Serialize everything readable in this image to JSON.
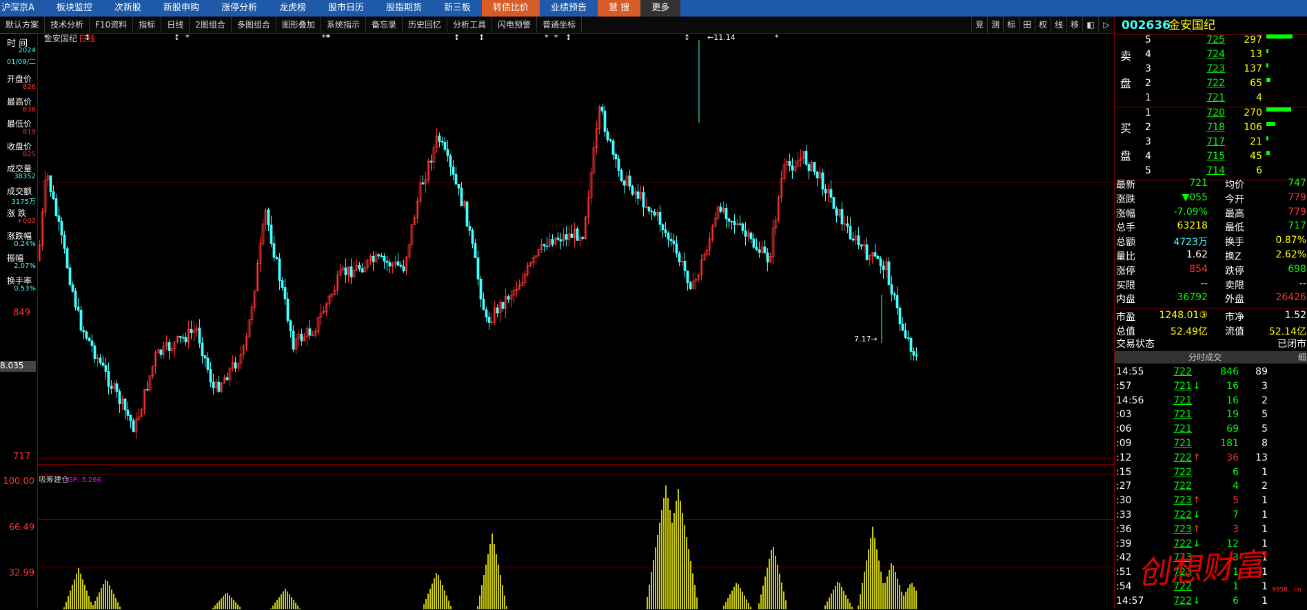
{
  "nav": {
    "items": [
      "沪深京A",
      "板块监控",
      "次新股",
      "新股申购",
      "涨停分析",
      "龙虎榜",
      "股市日历",
      "股指期货",
      "新三板",
      "转债比价",
      "业绩预告",
      "慧 搜",
      "更多"
    ]
  },
  "toolbar": {
    "items": [
      "默认方案",
      "技术分析",
      "F10资料",
      "指标",
      "日线",
      "2图组合",
      "多图组合",
      "图形叠加",
      "系统指示",
      "备忘录",
      "历史回忆",
      "分析工具",
      "闪电预警",
      "普通坐标"
    ],
    "icons": [
      "竞",
      "测",
      "标",
      "田",
      "权",
      "线",
      "移",
      "◧",
      "▷"
    ]
  },
  "left_panel": {
    "time_label": "时 间",
    "year": "2024",
    "date": "01/09/二",
    "rows": [
      {
        "label": "开盘价",
        "value": "826"
      },
      {
        "label": "最高价",
        "value": "836"
      },
      {
        "label": "最低价",
        "value": "819"
      },
      {
        "label": "收盘价",
        "value": "825"
      },
      {
        "label": "成交量",
        "value": "38352"
      },
      {
        "label": "成交额",
        "value": "3175万"
      },
      {
        "label": "涨 跌",
        "value": "+002"
      },
      {
        "label": "涨跌幅",
        "value": "0.24%"
      },
      {
        "label": "振幅",
        "value": "2.07%"
      },
      {
        "label": "换手率",
        "value": "0.53%"
      }
    ]
  },
  "chart": {
    "stock_name": "金安国纪",
    "period": "日线",
    "high_label": "11.14",
    "low_label": "7.17",
    "price_axis": [
      "849",
      "717"
    ],
    "crosshair_value": "8.035",
    "indicator_name": "吸筹建仓",
    "indicator_value": "GP: 3.266",
    "indicator_axis": [
      "100.00",
      "66.49",
      "32.99"
    ],
    "markers": [
      "*",
      "↕",
      "↕",
      "*",
      "**",
      "*",
      "↕",
      "↕",
      "*",
      "*",
      "↕",
      "↕"
    ]
  },
  "quote": {
    "code": "002636",
    "name": "金安国纪",
    "sell_label": [
      "卖",
      "盘"
    ],
    "buy_label": [
      "买",
      "盘"
    ],
    "asks": [
      {
        "lvl": "5",
        "price": "725",
        "vol": "297",
        "bar": 0.9
      },
      {
        "lvl": "4",
        "price": "724",
        "vol": "13",
        "bar": 0.05
      },
      {
        "lvl": "3",
        "price": "723",
        "vol": "137",
        "bar": 0.08
      },
      {
        "lvl": "2",
        "price": "722",
        "vol": "65",
        "bar": 0.15
      },
      {
        "lvl": "1",
        "price": "721",
        "vol": "4",
        "bar": 0.0
      }
    ],
    "bids": [
      {
        "lvl": "1",
        "price": "720",
        "vol": "270",
        "bar": 0.85
      },
      {
        "lvl": "2",
        "price": "718",
        "vol": "106",
        "bar": 0.3
      },
      {
        "lvl": "3",
        "price": "717",
        "vol": "21",
        "bar": 0.05
      },
      {
        "lvl": "4",
        "price": "715",
        "vol": "45",
        "bar": 0.12
      },
      {
        "lvl": "5",
        "price": "714",
        "vol": "6",
        "bar": 0.0
      }
    ],
    "stats": [
      {
        "l1": "最新",
        "v1": "721",
        "l2": "均价",
        "v2": "747",
        "c1": "#0f0",
        "c2": "#0f0"
      },
      {
        "l1": "涨跌",
        "v1": "▼055",
        "l2": "今开",
        "v2": "779",
        "c1": "#0f0",
        "c2": "#f33"
      },
      {
        "l1": "涨幅",
        "v1": "-7.09%",
        "l2": "最高",
        "v2": "779",
        "c1": "#0f0",
        "c2": "#f33"
      },
      {
        "l1": "总手",
        "v1": "63218",
        "l2": "最低",
        "v2": "717",
        "c1": "#ff0",
        "c2": "#0f0"
      },
      {
        "l1": "总额",
        "v1": "4723万",
        "l2": "换手",
        "v2": "0.87%",
        "c1": "#4ff",
        "c2": "#ff0"
      },
      {
        "l1": "量比",
        "v1": "1.62",
        "l2": "换Z",
        "v2": "2.62%",
        "c1": "#fff",
        "c2": "#ff0"
      },
      {
        "l1": "涨停",
        "v1": "854",
        "l2": "跌停",
        "v2": "698",
        "c1": "#f33",
        "c2": "#0f0"
      },
      {
        "l1": "买限",
        "v1": "--",
        "l2": "卖限",
        "v2": "--",
        "c1": "#fff",
        "c2": "#fff"
      },
      {
        "l1": "内盘",
        "v1": "36792",
        "l2": "外盘",
        "v2": "26426",
        "c1": "#0f0",
        "c2": "#f33"
      }
    ],
    "stats2": [
      {
        "l1": "市盈",
        "v1": "1248.01③",
        "l2": "市净",
        "v2": "1.52",
        "c1": "#ff0",
        "c2": "#fff"
      },
      {
        "l1": "总值",
        "v1": "52.49亿",
        "l2": "流值",
        "v2": "52.14亿",
        "c1": "#ff0",
        "c2": "#ff0"
      }
    ],
    "trade_status_label": "交易状态",
    "trade_status": "已闭市",
    "ticks_header": "分时成交",
    "ticks_tab": "细",
    "ticks": [
      {
        "time": "14:55",
        "price": "722",
        "arrow": "",
        "vol": "846",
        "cnt": "89",
        "volc": "#0f0"
      },
      {
        "time": ":57",
        "price": "721",
        "arrow": "↓",
        "vol": "16",
        "cnt": "3",
        "volc": "#0f0"
      },
      {
        "time": "14:56",
        "price": "721",
        "arrow": "",
        "vol": "16",
        "cnt": "2",
        "volc": "#0f0"
      },
      {
        "time": ":03",
        "price": "721",
        "arrow": "",
        "vol": "19",
        "cnt": "5",
        "volc": "#0f0"
      },
      {
        "time": ":06",
        "price": "721",
        "arrow": "",
        "vol": "69",
        "cnt": "5",
        "volc": "#0f0"
      },
      {
        "time": ":09",
        "price": "721",
        "arrow": "",
        "vol": "181",
        "cnt": "8",
        "volc": "#0f0"
      },
      {
        "time": ":12",
        "price": "722",
        "arrow": "↑",
        "vol": "36",
        "cnt": "13",
        "volc": "#f33"
      },
      {
        "time": ":15",
        "price": "722",
        "arrow": "",
        "vol": "6",
        "cnt": "1",
        "volc": "#0f0"
      },
      {
        "time": ":27",
        "price": "722",
        "arrow": "",
        "vol": "4",
        "cnt": "2",
        "volc": "#0f0"
      },
      {
        "time": ":30",
        "price": "723",
        "arrow": "↑",
        "vol": "5",
        "cnt": "1",
        "volc": "#f33"
      },
      {
        "time": ":33",
        "price": "722",
        "arrow": "↓",
        "vol": "7",
        "cnt": "1",
        "volc": "#0f0"
      },
      {
        "time": ":36",
        "price": "723",
        "arrow": "↑",
        "vol": "3",
        "cnt": "1",
        "volc": "#f33"
      },
      {
        "time": ":39",
        "price": "722",
        "arrow": "↓",
        "vol": "12",
        "cnt": "1",
        "volc": "#0f0"
      },
      {
        "time": ":42",
        "price": "723",
        "arrow": "",
        "vol": "3",
        "cnt": "1",
        "volc": "#0f0"
      },
      {
        "time": ":51",
        "price": "723",
        "arrow": "",
        "vol": "1",
        "cnt": "1",
        "volc": "#0f0"
      },
      {
        "time": ":54",
        "price": "722",
        "arrow": "",
        "vol": "1",
        "cnt": "1",
        "volc": "#0f0"
      },
      {
        "time": "14:57",
        "price": "722",
        "arrow": "↓",
        "vol": "6",
        "cnt": "1",
        "volc": "#0f0"
      }
    ]
  },
  "watermark": {
    "text": "创想财富",
    "url": "9958…cn"
  },
  "colors": {
    "nav_bg": "#1e5aa8",
    "up": "#f33",
    "down": "#4ff",
    "grid": "#800",
    "indicator": "#cc0"
  }
}
